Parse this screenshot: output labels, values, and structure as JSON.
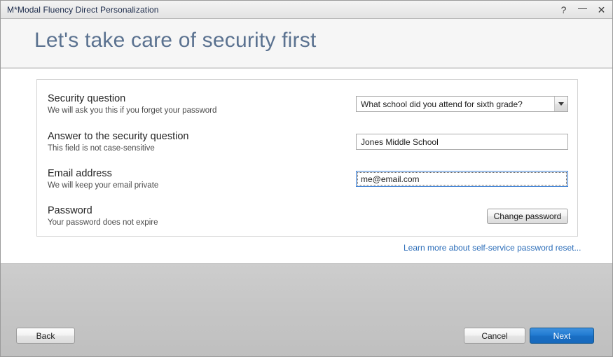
{
  "window": {
    "title": "M*Modal Fluency Direct Personalization",
    "caption_buttons": [
      {
        "name": "help",
        "glyph": "?"
      },
      {
        "name": "minimize",
        "glyph": "—"
      },
      {
        "name": "close",
        "glyph": "✕"
      }
    ]
  },
  "header": {
    "page_title": "Let's take care of security first"
  },
  "form": {
    "fields": [
      {
        "title": "Security question",
        "subtitle": "We will ask you this if you forget your password",
        "control": "combobox",
        "value": "What school did you attend for sixth grade?",
        "options": [
          "What school did you attend for sixth grade?"
        ]
      },
      {
        "title": "Answer to the security question",
        "subtitle": "This field is not case-sensitive",
        "control": "textbox",
        "value": "Jones Middle School",
        "placeholder": ""
      },
      {
        "title": "Email address",
        "subtitle": "We will keep your email private",
        "control": "textbox",
        "value": "me@email.com",
        "placeholder": "",
        "focused": true
      },
      {
        "title": "Password",
        "subtitle": "Your password does not expire",
        "control": "button",
        "button_label": "Change password"
      }
    ]
  },
  "links": {
    "learn_more": "Learn more about self-service password reset..."
  },
  "footer": {
    "back_label": "Back",
    "cancel_label": "Cancel",
    "next_label": "Next"
  },
  "colors": {
    "accent_blue": "#1f79d0",
    "link_blue": "#2a6cb8",
    "title_blue_gray": "#5b7290",
    "footer_gray": "#c6c6c6",
    "panel_border": "#d4d4d4"
  }
}
